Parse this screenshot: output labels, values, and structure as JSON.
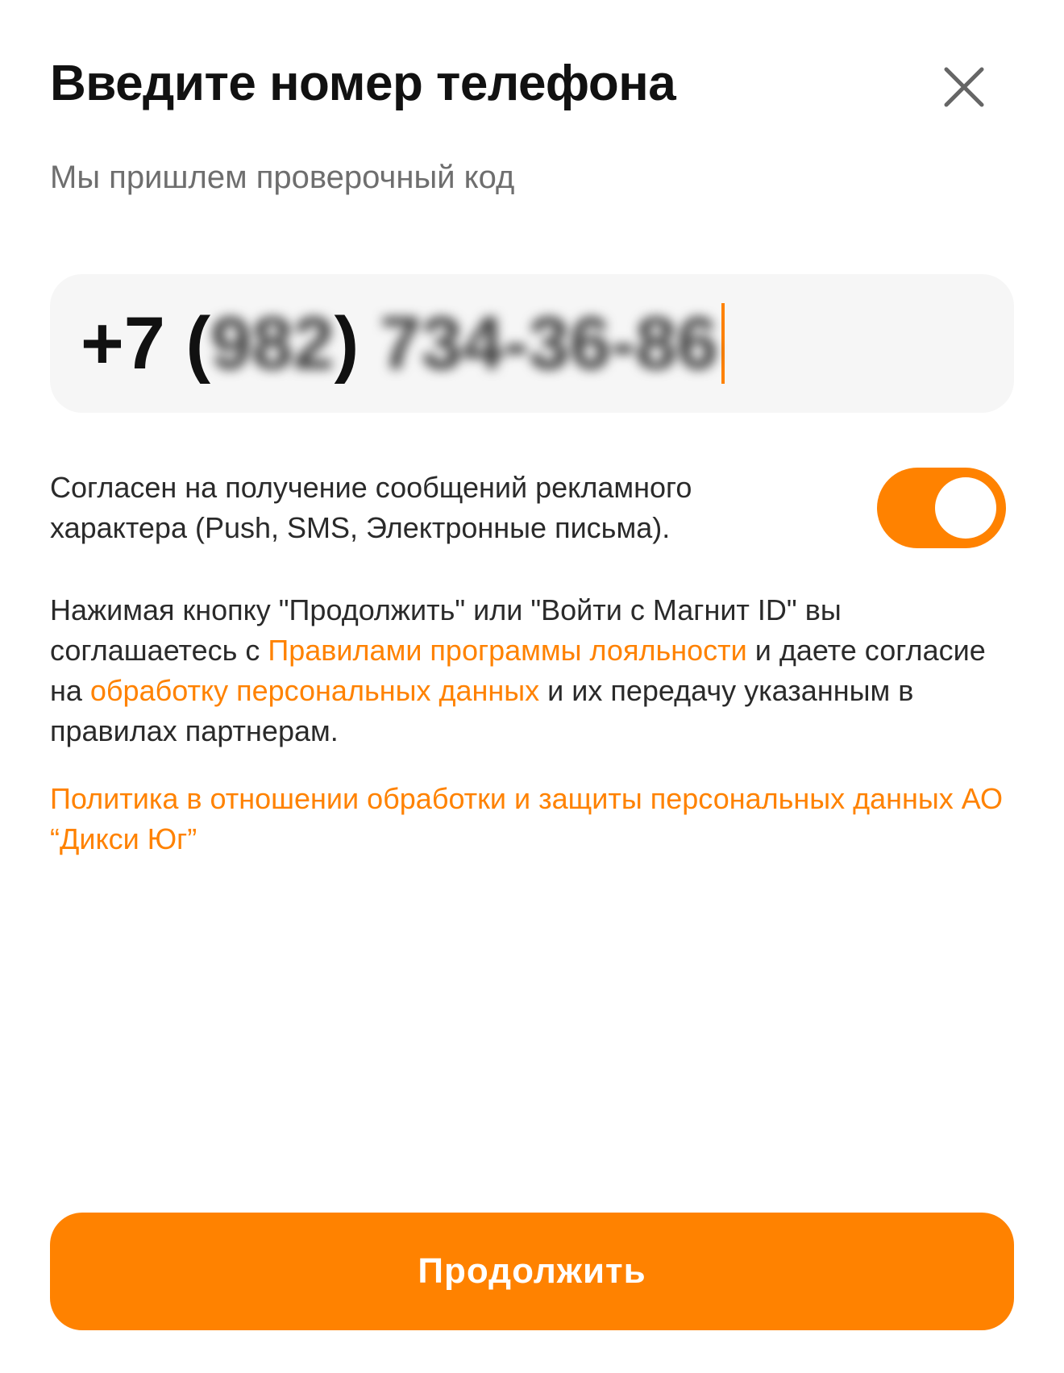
{
  "header": {
    "title": "Введите номер телефона",
    "close_icon": "close-icon"
  },
  "subtitle": "Мы пришлем проверочный код",
  "phone_input": {
    "prefix": "+7 (",
    "area_code_masked": "982",
    "close_paren": ")",
    "number_masked": "734-36-86",
    "accent_color": "#ff8200"
  },
  "marketing_consent": {
    "text": "Согласен на получение сообщений рекламного характера (Push, SMS, Электронные письма).",
    "enabled": true,
    "toggle_color": "#ff8200"
  },
  "agreement": {
    "part1": "Нажимая кнопку \"Продолжить\" или \"Войти с Магнит ID\" вы соглашаетесь с ",
    "link1": "Правилами программы лояльности",
    "part2": " и даете согласие на ",
    "link2": "обработку персональных данных",
    "part3": " и их передачу указанным в правилах партнерам."
  },
  "policy_link": "Политика в отношении обработки и защиты персональных данных АО “Дикси Юг”",
  "continue_button": {
    "label": "Продолжить",
    "color": "#ff8200"
  }
}
